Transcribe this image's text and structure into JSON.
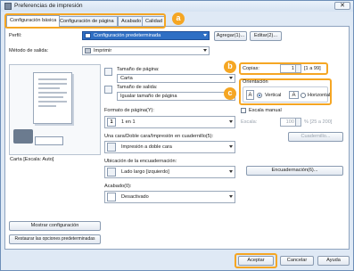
{
  "window": {
    "title": "Preferencias de impresión",
    "close_glyph": "✕"
  },
  "tabs": [
    {
      "label": "Configuración básica"
    },
    {
      "label": "Configuración de página"
    },
    {
      "label": "Acabado"
    },
    {
      "label": "Calidad"
    }
  ],
  "callouts": {
    "a": "a",
    "b": "b",
    "c": "c"
  },
  "profile": {
    "label": "Perfil:",
    "value": "Configuración predeterminada",
    "add_button": "Agregar(1)...",
    "edit_button": "Editar(2)..."
  },
  "output_method": {
    "label": "Método de salida:",
    "value": "Imprimir"
  },
  "preview": {
    "caption": "Carta [Escala: Auto]"
  },
  "left_buttons": {
    "show_settings": "Mostrar configuración",
    "restore_defaults": "Restaurar las opciones predeterminadas"
  },
  "page_size": {
    "label": "Tamaño de página:",
    "value": "Carta"
  },
  "output_size": {
    "label": "Tamaño de salida:",
    "value": "Igualar tamaño de página"
  },
  "copies": {
    "label": "Copias:",
    "value": "1",
    "range": "[1 a 99]"
  },
  "orientation": {
    "title": "Orientación",
    "vertical_label": "Vertical",
    "horizontal_label": "Horizontal",
    "selected": "Vertical"
  },
  "page_layout": {
    "label": "Formato de página(Y):",
    "icon_text": "1",
    "value": "1 en 1"
  },
  "manual_scaling": {
    "label": "Escala manual",
    "scale_label": "Escala:",
    "scale_value": "100",
    "scale_range": "% [25 a 200]",
    "checked": false
  },
  "booklet_button": "Cuadernillo...",
  "duplex": {
    "label": "Una cara/Doble cara/Impresión en cuadernillo(5):",
    "value": "Impresión a doble cara"
  },
  "binding": {
    "label": "Ubicación de la encuadernación:",
    "value": "Lado largo [izquierdo]",
    "button": "Encuadernación(6)..."
  },
  "finishing": {
    "label": "Acabado(0):",
    "value": "Desactivado"
  },
  "footer": {
    "accept": "Aceptar",
    "cancel": "Cancelar",
    "help": "Ayuda"
  },
  "colors": {
    "accent": "#f5a623",
    "selection": "#2f6fc4",
    "border": "#8ea3bf"
  }
}
